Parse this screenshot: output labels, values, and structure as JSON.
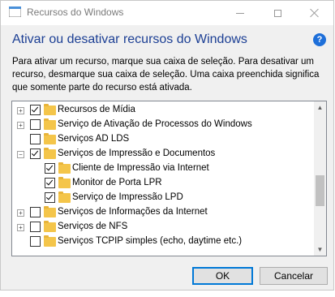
{
  "window": {
    "title": "Recursos do Windows"
  },
  "heading": "Ativar ou desativar recursos do Windows",
  "help_glyph": "?",
  "description": "Para ativar um recurso, marque sua caixa de seleção. Para desativar um recurso, desmarque sua caixa de seleção. Uma caixa preenchida significa que somente parte do recurso está ativada.",
  "features": [
    {
      "label": "Recursos de Mídia",
      "expander": "+",
      "checked": true,
      "level": 0
    },
    {
      "label": "Serviço de Ativação de Processos do Windows",
      "expander": "+",
      "checked": false,
      "level": 0
    },
    {
      "label": "Serviços AD LDS",
      "expander": "",
      "checked": false,
      "level": 0
    },
    {
      "label": "Serviços de Impressão e Documentos",
      "expander": "−",
      "checked": true,
      "level": 0
    },
    {
      "label": "Cliente de Impressão via Internet",
      "expander": "",
      "checked": true,
      "level": 1
    },
    {
      "label": "Monitor de Porta LPR",
      "expander": "",
      "checked": true,
      "level": 1
    },
    {
      "label": "Serviço de Impressão LPD",
      "expander": "",
      "checked": true,
      "level": 1
    },
    {
      "label": "Serviços de Informações da Internet",
      "expander": "+",
      "checked": false,
      "level": 0
    },
    {
      "label": "Serviços de NFS",
      "expander": "+",
      "checked": false,
      "level": 0
    },
    {
      "label": "Serviços TCPIP simples (echo, daytime etc.)",
      "expander": "",
      "checked": false,
      "level": 0
    }
  ],
  "buttons": {
    "ok": "OK",
    "cancel": "Cancelar"
  }
}
